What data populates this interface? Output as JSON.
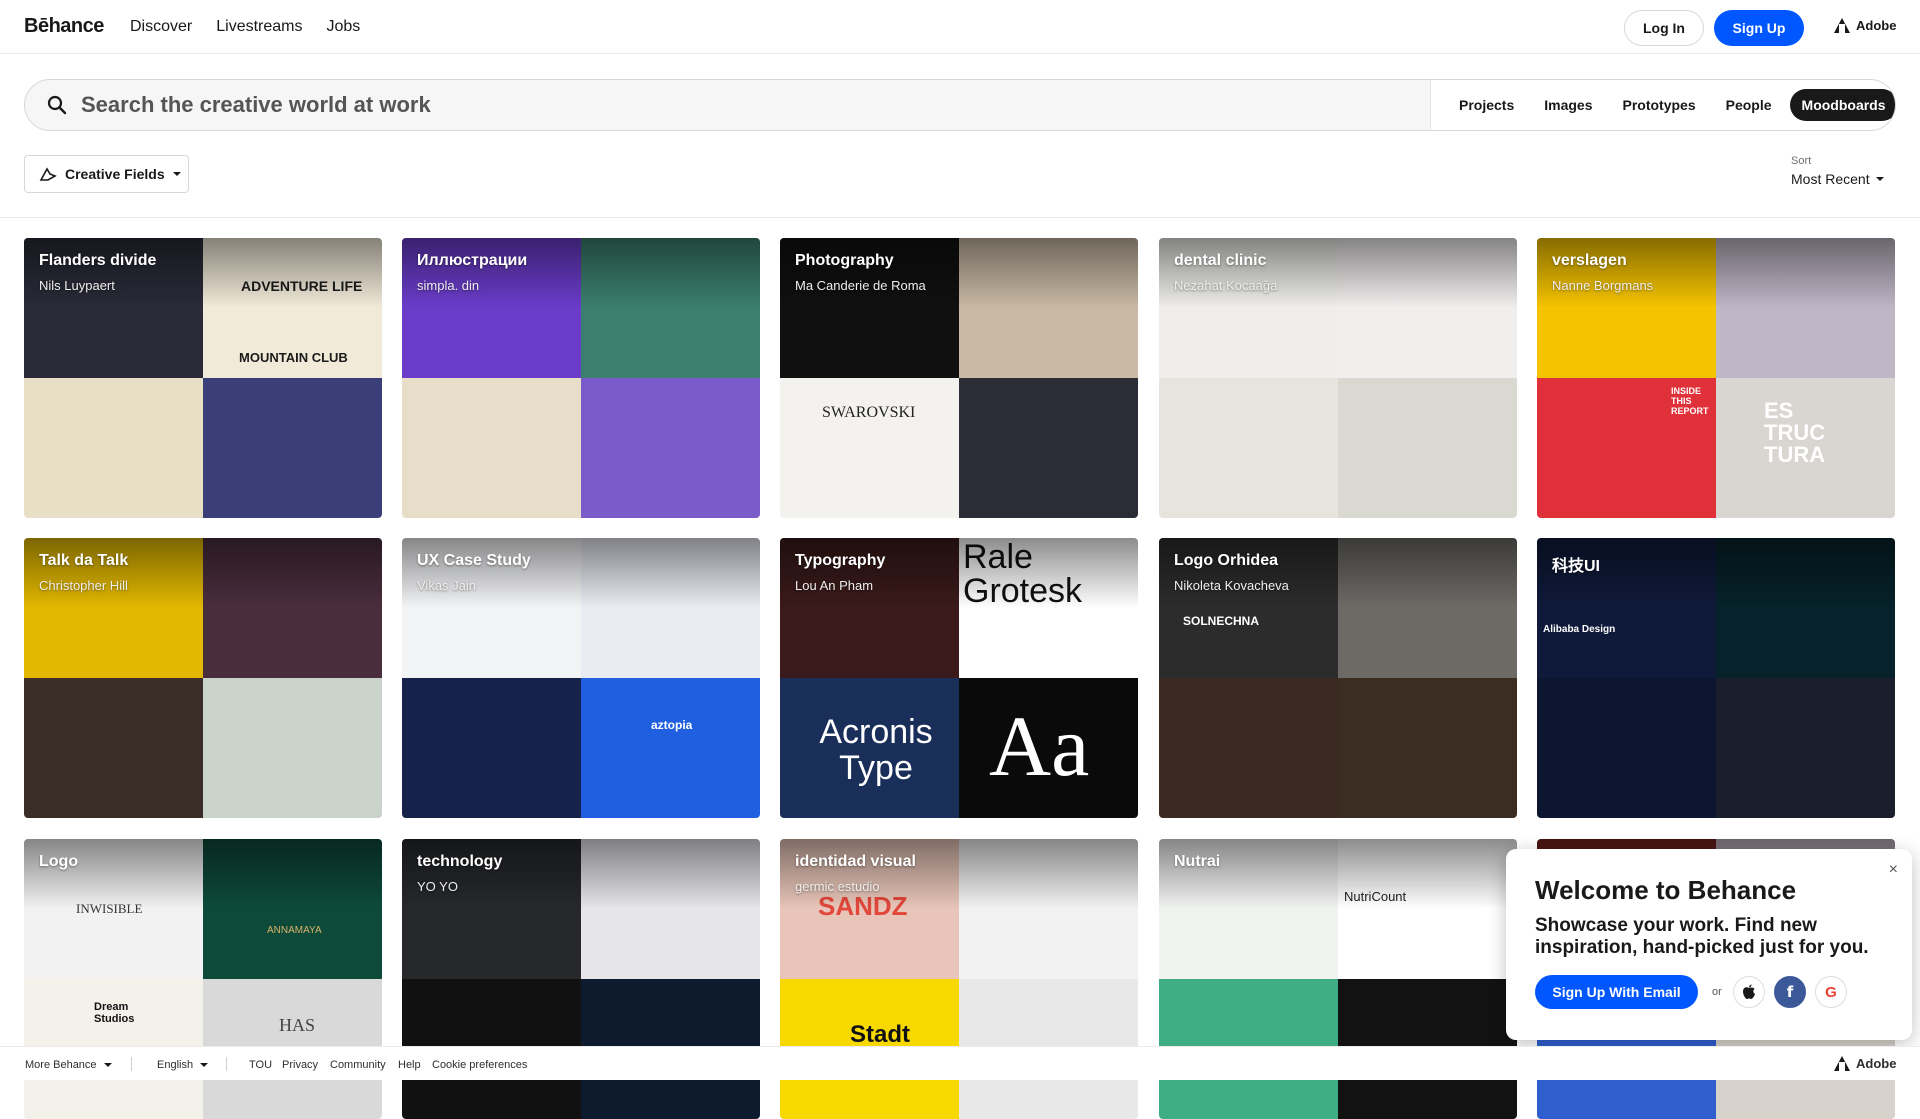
{
  "nav": {
    "logo": "Bēhance",
    "links": [
      "Discover",
      "Livestreams",
      "Jobs"
    ],
    "login_label": "Log In",
    "signup_label": "Sign Up",
    "adobe_label": "Adobe"
  },
  "search": {
    "placeholder": "Search the creative world at work",
    "tabs": [
      "Projects",
      "Images",
      "Prototypes",
      "People",
      "Moodboards"
    ],
    "active_tab": "Moodboards"
  },
  "filters": {
    "creative_fields_label": "Creative Fields",
    "sort_label": "Sort",
    "sort_value": "Most Recent"
  },
  "moodboards": [
    {
      "title": "Flanders divide",
      "owner": "Nils Luypaert",
      "colors": [
        "#2a2a38",
        "#f2ead9",
        "#e8dfc7",
        "#3a3f7a"
      ]
    },
    {
      "title": "Иллюстрации",
      "owner": "simpla. din",
      "colors": [
        "#6a3cc9",
        "#3b7f6e",
        "#e8ddc8",
        "#7a5bc9"
      ]
    },
    {
      "title": "Photography",
      "owner": "Ma Canderie de Roma",
      "colors": [
        "#101010",
        "#c9b9a5",
        "#f4f2ef",
        "#2a2d36"
      ]
    },
    {
      "title": "dental clinic",
      "owner": "Nezahat Kocaağa",
      "colors": [
        "#efeeea",
        "#f1eeee",
        "#e6e4dd",
        "#d9d9d2"
      ]
    },
    {
      "title": "verslagen",
      "owner": "Nanne Borgmans",
      "colors": [
        "#f5c400",
        "#bfb6c6",
        "#e0313a",
        "#d9d6d2"
      ]
    },
    {
      "title": "Talk da Talk",
      "owner": "Christopher Hill",
      "colors": [
        "#e2b800",
        "#4a2d3d",
        "#3a2d28",
        "#c9d3c9"
      ]
    },
    {
      "title": "UX Case Study",
      "owner": "Vikas Jain",
      "colors": [
        "#f3f4f6",
        "#e9ecf3",
        "#16224a",
        "#1f5fe0"
      ]
    },
    {
      "title": "Typography",
      "owner": "Lou An Pham",
      "colors": [
        "#3a1a1a",
        "#ffffff",
        "#1a2e5a",
        "#0a0a0a"
      ]
    },
    {
      "title": "Logo Orhidea",
      "owner": "Nikoleta Kovacheva",
      "colors": [
        "#2c2c2c",
        "#6d6a66",
        "#3a2a22",
        "#3b2d21"
      ]
    },
    {
      "title": "科技UI",
      "owner": "",
      "colors": [
        "#0f1a3a",
        "#06222a",
        "#0c1630",
        "#1b1e2c"
      ]
    },
    {
      "title": "Logo",
      "owner": "",
      "colors": [
        "#f2f2f2",
        "#0d4a3a",
        "#f4f0ea",
        "#d9d9d9"
      ]
    },
    {
      "title": "technology",
      "owner": "YO YO",
      "colors": [
        "#26282c",
        "#e6e6e9",
        "#111111",
        "#0e1b2e"
      ]
    },
    {
      "title": "identidad visual",
      "owner": "germic estudio",
      "colors": [
        "#e8c5b8",
        "#f2f2f2",
        "#f7d800",
        "#e8e8e8"
      ]
    },
    {
      "title": "Nutrai",
      "owner": "",
      "colors": [
        "#f1f3f1",
        "#ffffff",
        "#3fae84",
        "#121212"
      ]
    },
    {
      "title": "",
      "owner": "",
      "colors": [
        "#7a2520",
        "#c7b8c2",
        "#2f5fcf",
        "#d8d2cc"
      ]
    }
  ],
  "quad_text": {
    "adventure": "ADVENTURE LIFE",
    "mountain": "MOUNTAIN CLUB",
    "swarovski": "SWAROVSKI",
    "rale": "Rale Grotesk",
    "acronis": "Acronis Type",
    "aa": "Aa",
    "inwisible": "INWISIBLE",
    "sandz": "SANDZ",
    "stadt": "Stadt",
    "nutricount": "NutriCount",
    "aztopia": "aztopia",
    "alibaba": "Alibaba Design",
    "inside": "INSIDE THIS REPORT",
    "estruc": "ES TRUC TURA",
    "dream": "Dream Studios",
    "annamaya": "ANNAMAYA",
    "has": "HAS",
    "solnechna": "SOLNECHNA"
  },
  "modal": {
    "title": "Welcome to Behance",
    "body": "Showcase your work. Find new inspiration, hand-picked just for you.",
    "email_label": "Sign Up With Email",
    "or": "or",
    "close": "×",
    "apple": "",
    "facebook": "f",
    "google": "G"
  },
  "footer": {
    "more": "More Behance",
    "language": "English",
    "links": [
      "TOU",
      "Privacy",
      "Community",
      "Help",
      "Cookie preferences"
    ],
    "adobe": "Adobe"
  }
}
